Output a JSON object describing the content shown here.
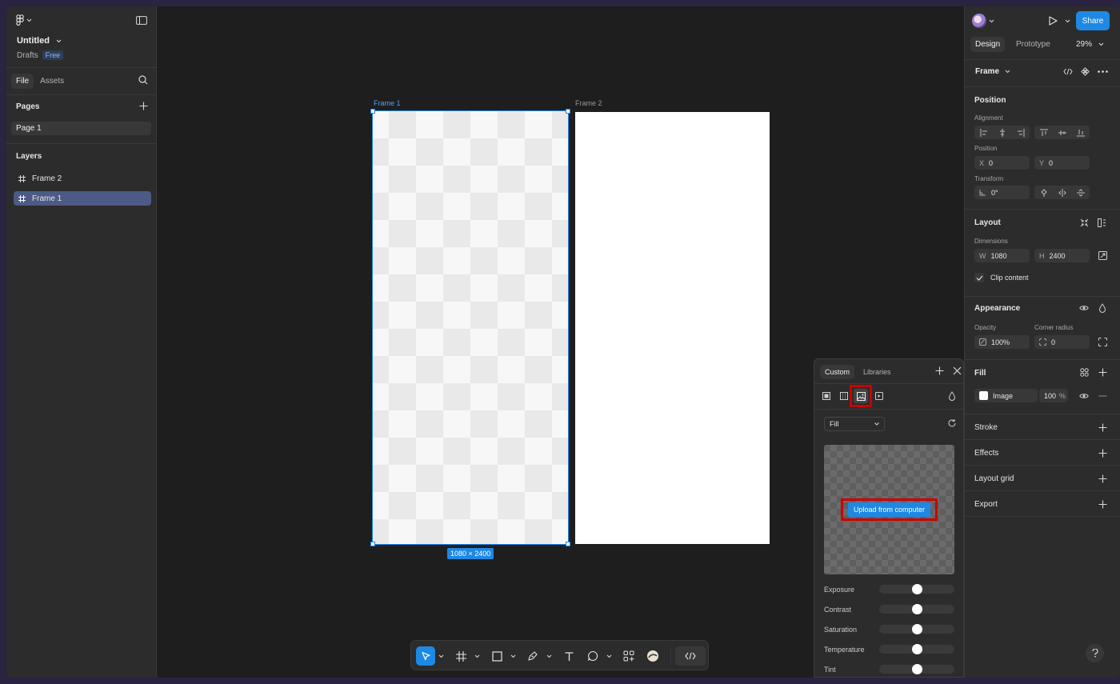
{
  "left_panel": {
    "file_title": "Untitled",
    "location": "Drafts",
    "plan_badge": "Free",
    "tabs": [
      "File",
      "Assets"
    ],
    "pages_label": "Pages",
    "pages": [
      "Page 1"
    ],
    "layers_label": "Layers",
    "layers": [
      "Frame 2",
      "Frame 1"
    ]
  },
  "canvas": {
    "frame1_label": "Frame 1",
    "frame2_label": "Frame 2",
    "selection_dims": "1080 × 2400"
  },
  "fill_picker": {
    "tabs": [
      "Custom",
      "Libraries"
    ],
    "mode": "Fill",
    "upload_label": "Upload from computer",
    "adjustments": [
      {
        "label": "Exposure",
        "value": 0.5
      },
      {
        "label": "Contrast",
        "value": 0.5
      },
      {
        "label": "Saturation",
        "value": 0.5
      },
      {
        "label": "Temperature",
        "value": 0.5
      },
      {
        "label": "Tint",
        "value": 0.5
      }
    ]
  },
  "right_panel": {
    "share_label": "Share",
    "tabs": [
      "Design",
      "Prototype"
    ],
    "zoom": "29%",
    "selection_type": "Frame",
    "position": {
      "title": "Position",
      "alignment_label": "Alignment",
      "position_label": "Position",
      "x_prefix": "X",
      "x": "0",
      "y_prefix": "Y",
      "y": "0",
      "transform_label": "Transform",
      "rotation": "0°"
    },
    "layout": {
      "title": "Layout",
      "dimensions_label": "Dimensions",
      "w_prefix": "W",
      "w": "1080",
      "h_prefix": "H",
      "h": "2400",
      "clip_label": "Clip content"
    },
    "appearance": {
      "title": "Appearance",
      "opacity_label": "Opacity",
      "opacity": "100%",
      "radius_label": "Corner radius",
      "radius": "0"
    },
    "fill": {
      "title": "Fill",
      "type": "Image",
      "opacity": "100",
      "unit": "%"
    },
    "sections": [
      "Stroke",
      "Effects",
      "Layout grid",
      "Export"
    ]
  },
  "colors": {
    "accent": "#1e88e5",
    "highlight": "#cc0000",
    "layer_selected": "#4c5a85"
  }
}
